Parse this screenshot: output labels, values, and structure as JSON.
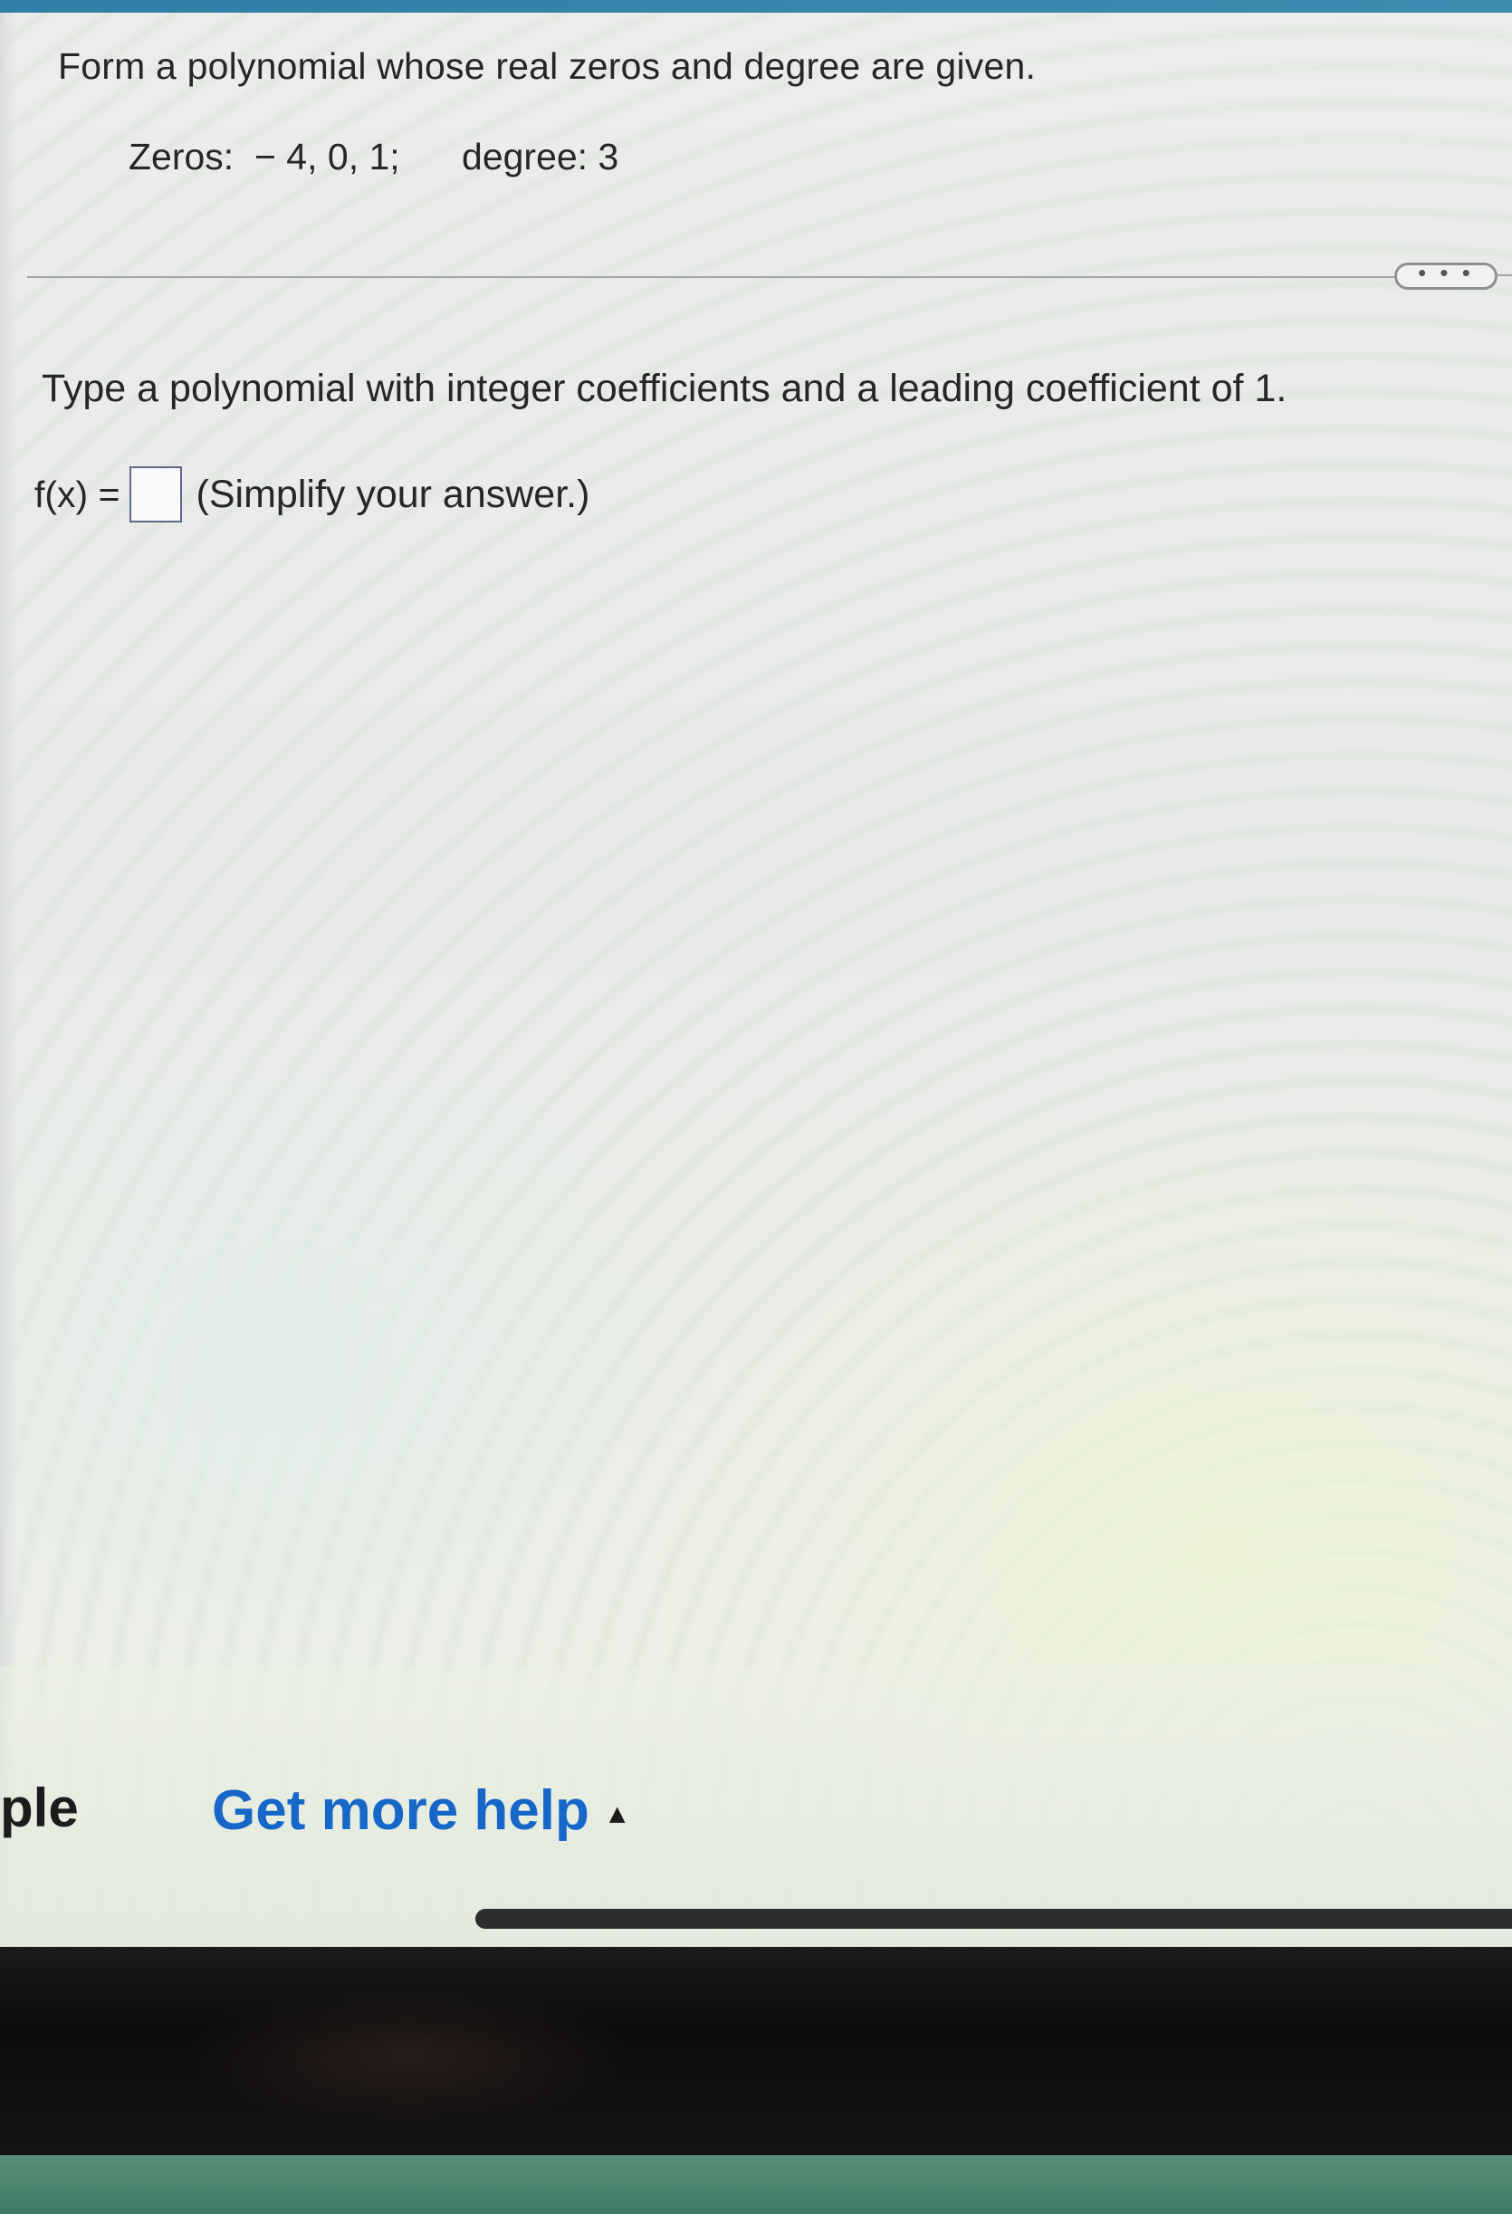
{
  "problem": {
    "statement": "Form a polynomial whose real zeros and degree are given.",
    "zeros_text": "Zeros:  − 4, 0, 1;      degree: 3"
  },
  "more_button": {
    "label": "• • •"
  },
  "answer": {
    "instruction": "Type a polynomial with integer coefficients and a leading coefficient of 1.",
    "function_label": "f(x) =",
    "value": "",
    "hint": "(Simplify your answer.)"
  },
  "footer": {
    "example_partial": "ple",
    "help_label": "Get more help",
    "help_caret": "▲"
  },
  "colors": {
    "link": "#1767c8",
    "top_strip": "#2f7fa6"
  }
}
